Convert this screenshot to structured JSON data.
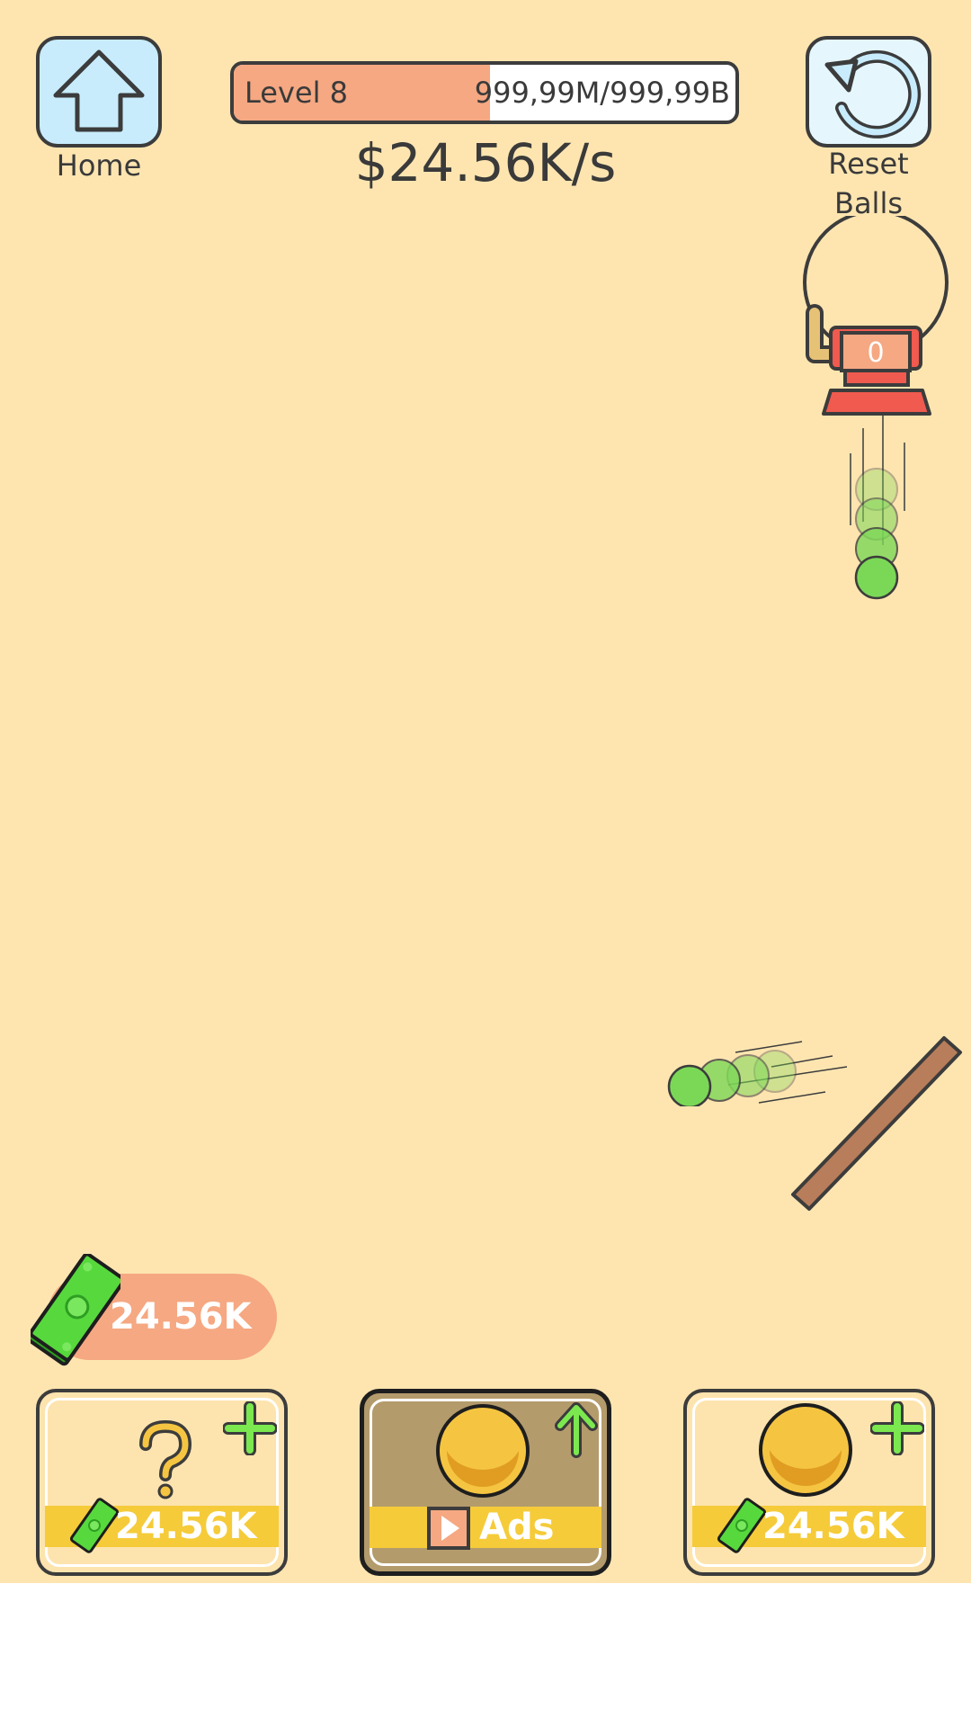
{
  "header": {
    "home_label": "Home",
    "reset_label": "Reset\nBalls",
    "level_label": "Level 8",
    "level_progress_text": "999,99M/999,99B",
    "level_progress_fraction": 0.51,
    "income_rate": "$24.56K/s"
  },
  "dispenser": {
    "counter": "0"
  },
  "wallet": {
    "money": "24.56K"
  },
  "shop": {
    "cards": [
      {
        "kind": "mystery-ball",
        "price": "24.56K",
        "icon": "question-mark-icon",
        "badge": "plus-icon"
      },
      {
        "kind": "upgrade-ball",
        "label": "Ads",
        "icon": "gold-ball-icon",
        "badge": "up-arrow-icon"
      },
      {
        "kind": "add-ball",
        "price": "24.56K",
        "icon": "gold-ball-icon",
        "badge": "plus-icon"
      }
    ]
  },
  "colors": {
    "background": "#fee5b0",
    "level_fill": "#f5a882",
    "ball_green": "#7bd857",
    "gold": "#f5c542",
    "price_band": "#f5cb3a",
    "plank": "#b87d5a",
    "dispenser_red": "#f05a4f"
  }
}
